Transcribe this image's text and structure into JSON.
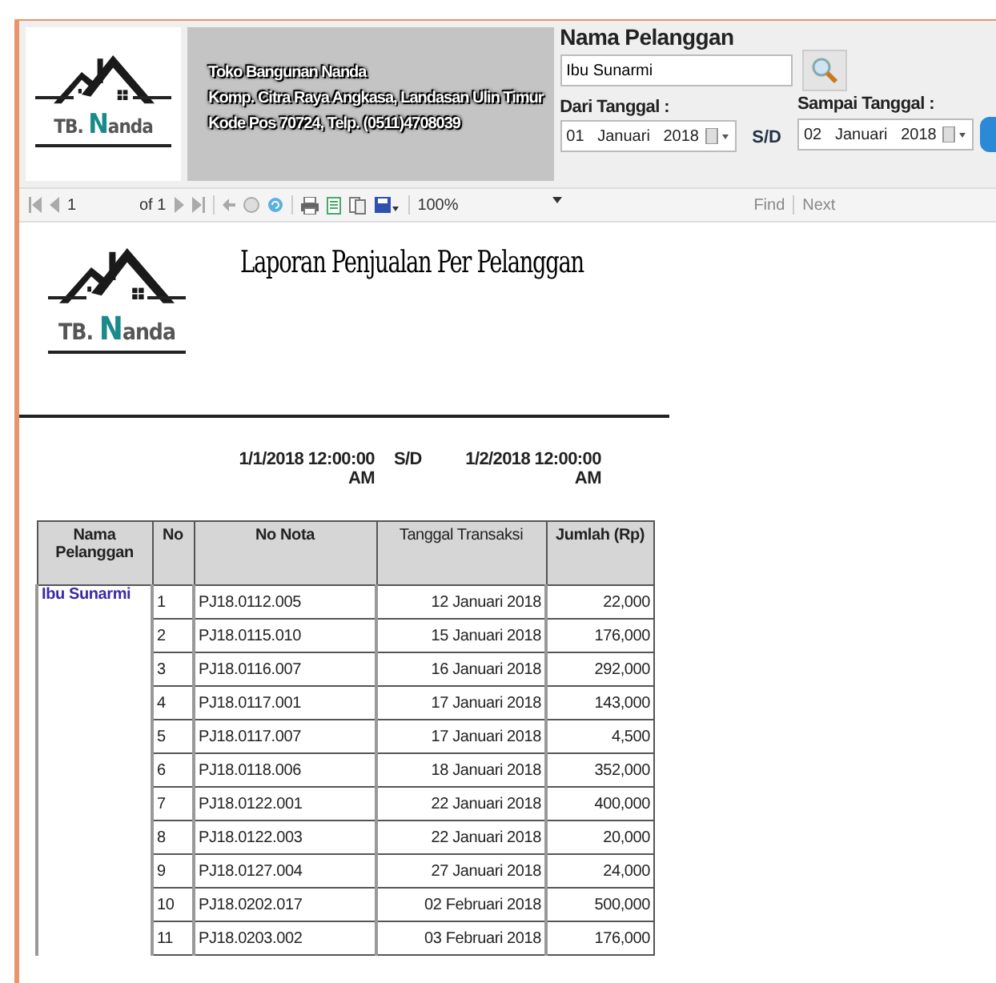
{
  "header": {
    "logo": {
      "prefix": "TB. ",
      "initial": "N",
      "rest": "anda"
    },
    "company_lines": [
      "Toko Bangunan Nanda",
      "Komp. Citra Raya Angkasa, Landasan Ulin Timur",
      "Kode Pos 70724, Telp. (0511)4708039"
    ],
    "customer": {
      "label": "Nama Pelanggan",
      "value": "Ibu Sunarmi"
    },
    "from": {
      "label": "Dari Tanggal :",
      "value": "01   Januari   2018"
    },
    "separator": "S/D",
    "to": {
      "label": "Sampai Tanggal :",
      "value": "02   Januari   2018"
    }
  },
  "toolbar": {
    "page": "1",
    "of": "of 1",
    "zoom": "100%",
    "find": "Find",
    "next": "Next"
  },
  "report": {
    "logo": {
      "prefix": "TB. ",
      "initial": "N",
      "rest": "anda"
    },
    "title": "Laporan Penjualan Per Pelanggan",
    "date_from": "1/1/2018 12:00:00 AM",
    "separator": "S/D",
    "date_to": "1/2/2018 12:00:00 AM",
    "columns": [
      "Nama Pelanggan",
      "No",
      "No Nota",
      "Tanggal Transaksi",
      "Jumlah (Rp)"
    ],
    "rows": [
      {
        "customer": "Ibu Sunarmi",
        "no": "1",
        "nota": "PJ18.0112.005",
        "date": "12 Januari 2018",
        "amount": "22,000"
      },
      {
        "no": "2",
        "nota": "PJ18.0115.010",
        "date": "15 Januari 2018",
        "amount": "176,000"
      },
      {
        "no": "3",
        "nota": "PJ18.0116.007",
        "date": "16 Januari 2018",
        "amount": "292,000"
      },
      {
        "no": "4",
        "nota": "PJ18.0117.001",
        "date": "17 Januari 2018",
        "amount": "143,000"
      },
      {
        "no": "5",
        "nota": "PJ18.0117.007",
        "date": "17 Januari 2018",
        "amount": "4,500"
      },
      {
        "no": "6",
        "nota": "PJ18.0118.006",
        "date": "18 Januari 2018",
        "amount": "352,000"
      },
      {
        "no": "7",
        "nota": "PJ18.0122.001",
        "date": "22 Januari 2018",
        "amount": "400,000"
      },
      {
        "no": "8",
        "nota": "PJ18.0122.003",
        "date": "22 Januari 2018",
        "amount": "20,000"
      },
      {
        "no": "9",
        "nota": "PJ18.0127.004",
        "date": "27 Januari 2018",
        "amount": "24,000"
      },
      {
        "no": "10",
        "nota": "PJ18.0202.017",
        "date": "02 Februari 2018",
        "amount": "500,000"
      },
      {
        "no": "11",
        "nota": "PJ18.0203.002",
        "date": "03 Februari 2018",
        "amount": "176,000"
      }
    ]
  }
}
